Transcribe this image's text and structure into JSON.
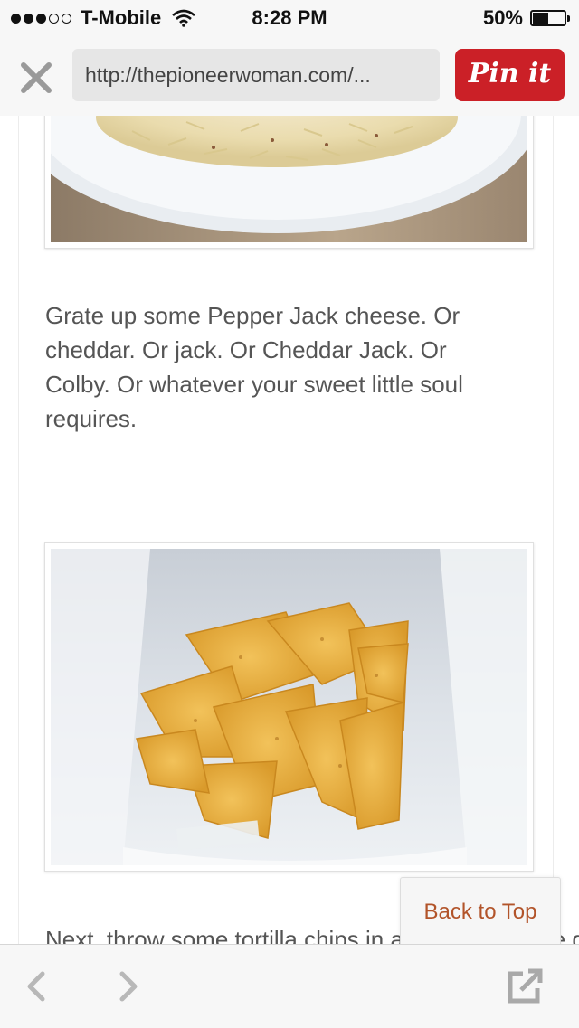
{
  "status": {
    "carrier": "T-Mobile",
    "time": "8:28 PM",
    "battery_percent": "50%",
    "battery_level": 0.5,
    "signal_bars_filled": 3,
    "signal_bars_total": 5
  },
  "browser": {
    "url": "http://thepioneerwoman.com/...",
    "pin_label": "Pin it",
    "pin_color": "#cb2027"
  },
  "content": {
    "paragraph_1": "Grate up some Pepper Jack cheese. Or cheddar. Or jack. Or Cheddar Jack. Or Colby. Or whatever your sweet little soul requires.",
    "paragraph_2": "Next, throw some tortilla chips in a bag. I used the good old fashion"
  },
  "back_to_top": "Back to Top",
  "colors": {
    "link": "#b2542a",
    "text": "#555555"
  },
  "icons": {
    "close": "close-icon",
    "back": "chevron-left-icon",
    "forward": "chevron-right-icon",
    "share": "share-icon",
    "wifi": "wifi-icon",
    "battery": "battery-icon"
  }
}
